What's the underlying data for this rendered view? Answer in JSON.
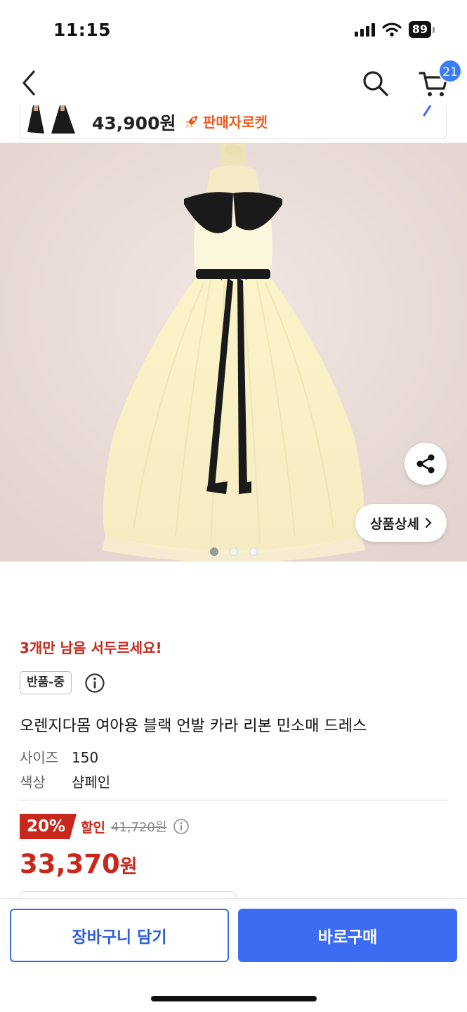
{
  "status_bar": {
    "time": "11:15",
    "battery": "89"
  },
  "nav": {
    "cart_count": "21"
  },
  "mini_bar": {
    "price": "43,900원",
    "rocket_label": "판매자로켓"
  },
  "hero": {
    "detail_label": "상품상세",
    "image_count": 3,
    "active_index": 0
  },
  "product": {
    "stock_notice": "3개만 남음 서두르세요!",
    "return_badge": "반품-중",
    "title": "오렌지다몸 여아용 블랙 언발 카라 리본 민소매 드레스",
    "options": [
      {
        "key": "사이즈",
        "value": "150"
      },
      {
        "key": "색상",
        "value": "샴페인"
      }
    ],
    "discount_percent": "20%",
    "discount_label": "할인",
    "original_price": "41,720원",
    "sale_price": "33,370",
    "sale_currency": "원"
  },
  "actions": {
    "cart_button": "장바구니 담기",
    "buy_button": "바로구매"
  },
  "colors": {
    "accent_blue": "#3b6cf2",
    "sale_red": "#c8281c",
    "rocket_orange": "#ef5a1e"
  }
}
